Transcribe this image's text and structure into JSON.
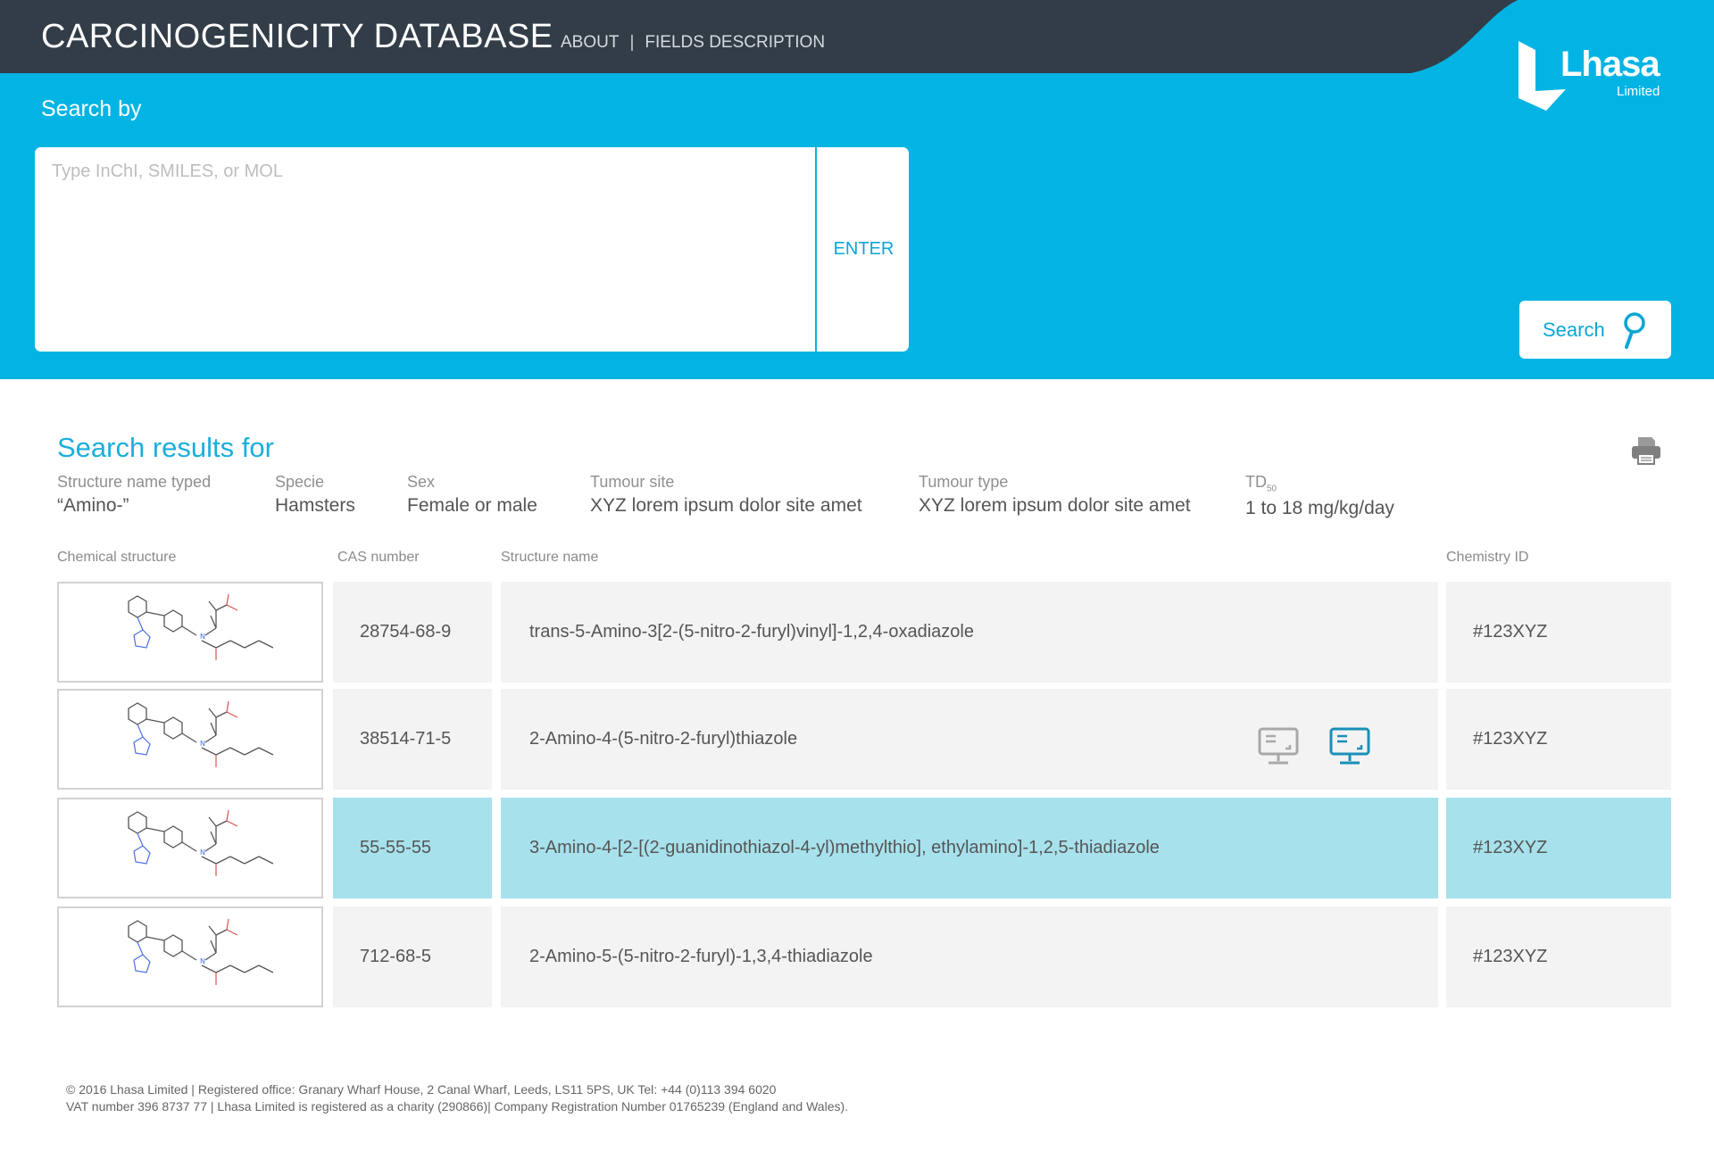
{
  "header": {
    "app_title": "CARCINOGENICITY DATABASE",
    "nav": [
      "ABOUT",
      "FIELDS DESCRIPTION"
    ],
    "nav_separator": "|",
    "logo_text": "Lhasa",
    "logo_subtext": "Limited"
  },
  "search": {
    "label": "Search by",
    "placeholder": "Type InChI, SMILES, or MOL",
    "value": "",
    "enter_label": "ENTER",
    "search_button_label": "Search"
  },
  "results": {
    "title": "Search results for",
    "criteria": [
      {
        "label": "Structure name typed",
        "value": "“Amino-”"
      },
      {
        "label": "Specie",
        "value": "Hamsters"
      },
      {
        "label": "Sex",
        "value": "Female or male"
      },
      {
        "label": "Tumour site",
        "value": "XYZ lorem ipsum dolor site amet"
      },
      {
        "label": "Tumour type",
        "value": "XYZ lorem ipsum dolor site amet"
      },
      {
        "label": "TD",
        "label_sub": "50",
        "value": "1 to 18 mg/kg/day"
      }
    ],
    "columns": {
      "structure": "Chemical structure",
      "cas": "CAS number",
      "name": "Structure name",
      "chem_id": "Chemistry ID"
    },
    "rows": [
      {
        "cas": "28754-68-9",
        "name": "trans-5-Amino-3[2-(5-nitro-2-furyl)vinyl]-1,2,4-oxadiazole",
        "chem_id": "#123XYZ"
      },
      {
        "cas": "38514-71-5",
        "name": "2-Amino-4-(5-nitro-2-furyl)thiazole",
        "chem_id": "#123XYZ"
      },
      {
        "cas": "55-55-55",
        "name": "3-Amino-4-[2-[(2-guanidinothiazol-4-yl)methylthio], ethylamino]-1,2,5-thiadiazole",
        "chem_id": "#123XYZ"
      },
      {
        "cas": "712-68-5",
        "name": "2-Amino-5-(5-nitro-2-furyl)-1,3,4-thiadiazole",
        "chem_id": "#123XYZ"
      }
    ],
    "selected_row_index": 2,
    "row_action_icons": [
      "monitor-icon",
      "monitor-icon"
    ]
  },
  "footer": {
    "line1": "© 2016 Lhasa Limited | Registered office: Granary Wharf House, 2 Canal Wharf, Leeds, LS11 5PS, UK Tel: +44 (0)113 394 6020",
    "line2": "VAT number 396 8737 77 | Lhasa Limited is registered as a charity (290866)| Company Registration Number 01765239 (England and Wales)."
  },
  "colors": {
    "brand_blue": "#02b4e3",
    "topbar": "#323d48",
    "accent_text": "#1aaedd",
    "selected_row": "#a7e1ec",
    "row_bg": "#f3f3f3"
  }
}
